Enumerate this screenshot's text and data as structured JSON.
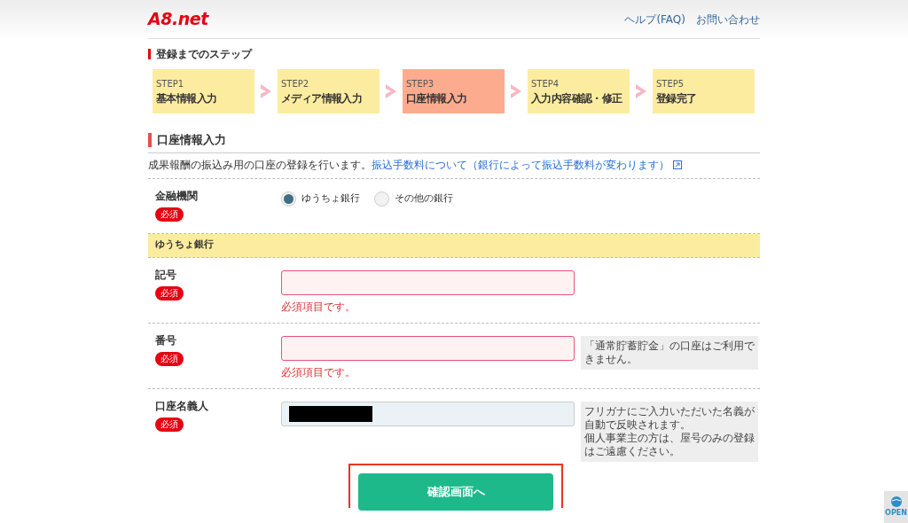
{
  "header": {
    "logo": "A8.net",
    "links": [
      "ヘルプ(FAQ)",
      "お問い合わせ"
    ]
  },
  "steps_title": "登録までのステップ",
  "steps": [
    {
      "step": "STEP1",
      "label": "基本情報入力",
      "selected": false
    },
    {
      "step": "STEP2",
      "label": "メディア情報入力",
      "selected": false
    },
    {
      "step": "STEP3",
      "label": "口座情報入力",
      "selected": true
    },
    {
      "step": "STEP4",
      "label": "入力内容確認・修正",
      "selected": false
    },
    {
      "step": "STEP5",
      "label": "登録完了",
      "selected": false
    }
  ],
  "section": {
    "title": "口座情報入力",
    "description": "成果報酬の振込み用の口座の登録を行います。",
    "link": "振込手数料について（銀行によって振込手数料が変わります）"
  },
  "bank": {
    "label": "金融機関",
    "required": "必須",
    "options": [
      {
        "label": "ゆうちょ銀行",
        "selected": true
      },
      {
        "label": "その他の銀行",
        "selected": false
      }
    ]
  },
  "subsection": "ゆうちょ銀行",
  "fields": [
    {
      "label": "記号",
      "required": "必須",
      "error": "必須項目です。",
      "invalid": true,
      "redacted": false
    },
    {
      "label": "番号",
      "required": "必須",
      "error": "必須項目です。",
      "invalid": true,
      "redacted": false,
      "note": [
        "「通常貯蓄貯金」の口座はご利用できません。"
      ]
    },
    {
      "label": "口座名義人",
      "required": "必須",
      "invalid": false,
      "redacted": true,
      "note": [
        "フリガナにご入力いただいた名義が自動で反映されます。",
        "個人事業主の方は、屋号のみの登録はご遠慮ください。"
      ]
    }
  ],
  "submit": {
    "label": "確認画面へ",
    "highlighted": true
  },
  "widget": {
    "label": "OPEN"
  }
}
